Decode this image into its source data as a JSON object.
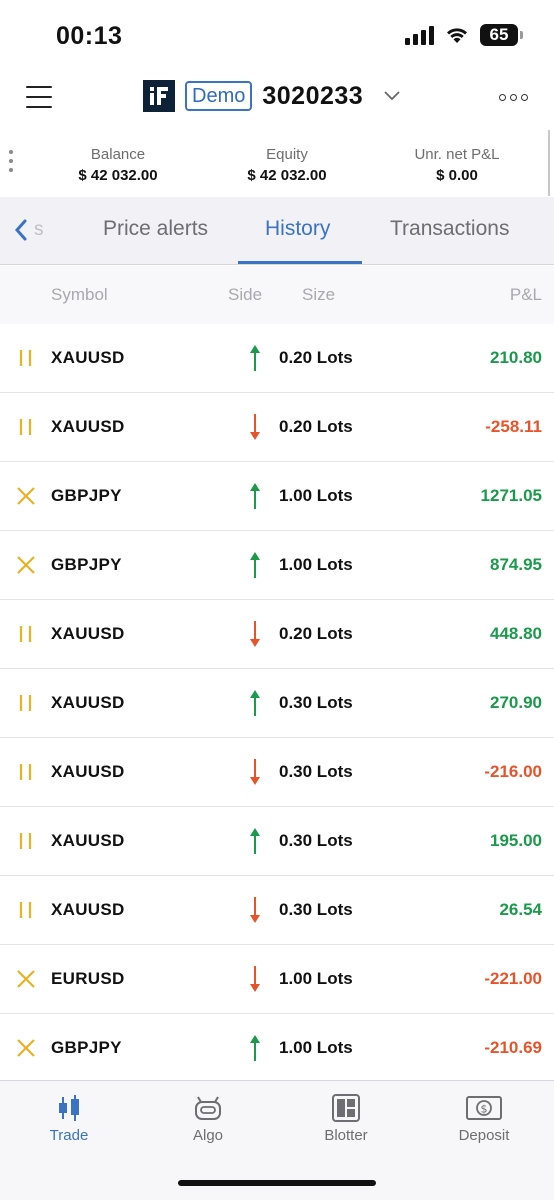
{
  "status_bar": {
    "time": "00:13",
    "battery": "65"
  },
  "header": {
    "badge": "Demo",
    "account_id": "3020233"
  },
  "summary": [
    {
      "label": "Balance",
      "value": "$ 42 032.00"
    },
    {
      "label": "Equity",
      "value": "$ 42 032.00"
    },
    {
      "label": "Unr. net P&L",
      "value": "$ 0.00"
    }
  ],
  "tabs": {
    "back_partial": "s",
    "items": [
      "Price alerts",
      "History",
      "Transactions"
    ],
    "active": "History"
  },
  "columns": {
    "symbol": "Symbol",
    "side": "Side",
    "size": "Size",
    "pnl": "P&L"
  },
  "rows": [
    {
      "status": "pause-icon",
      "symbol": "XAUUSD",
      "side": "buy",
      "size": "0.20 Lots",
      "pnl": "210.80",
      "pnl_sign": "positive"
    },
    {
      "status": "pause-icon",
      "symbol": "XAUUSD",
      "side": "sell",
      "size": "0.20 Lots",
      "pnl": "-258.11",
      "pnl_sign": "negative"
    },
    {
      "status": "close-icon",
      "symbol": "GBPJPY",
      "side": "buy",
      "size": "1.00 Lots",
      "pnl": "1271.05",
      "pnl_sign": "positive"
    },
    {
      "status": "close-icon",
      "symbol": "GBPJPY",
      "side": "buy",
      "size": "1.00 Lots",
      "pnl": "874.95",
      "pnl_sign": "positive"
    },
    {
      "status": "pause-icon",
      "symbol": "XAUUSD",
      "side": "sell",
      "size": "0.20 Lots",
      "pnl": "448.80",
      "pnl_sign": "positive"
    },
    {
      "status": "pause-icon",
      "symbol": "XAUUSD",
      "side": "buy",
      "size": "0.30 Lots",
      "pnl": "270.90",
      "pnl_sign": "positive"
    },
    {
      "status": "pause-icon",
      "symbol": "XAUUSD",
      "side": "sell",
      "size": "0.30 Lots",
      "pnl": "-216.00",
      "pnl_sign": "negative"
    },
    {
      "status": "pause-icon",
      "symbol": "XAUUSD",
      "side": "buy",
      "size": "0.30 Lots",
      "pnl": "195.00",
      "pnl_sign": "positive"
    },
    {
      "status": "pause-icon",
      "symbol": "XAUUSD",
      "side": "sell",
      "size": "0.30 Lots",
      "pnl": "26.54",
      "pnl_sign": "positive"
    },
    {
      "status": "close-icon",
      "symbol": "EURUSD",
      "side": "sell",
      "size": "1.00 Lots",
      "pnl": "-221.00",
      "pnl_sign": "negative"
    },
    {
      "status": "close-icon",
      "symbol": "GBPJPY",
      "side": "buy",
      "size": "1.00 Lots",
      "pnl": "-210.69",
      "pnl_sign": "negative"
    }
  ],
  "bottom_nav": [
    {
      "label": "Trade",
      "icon": "candlestick-icon",
      "active": true
    },
    {
      "label": "Algo",
      "icon": "robot-icon",
      "active": false
    },
    {
      "label": "Blotter",
      "icon": "blotter-icon",
      "active": false
    },
    {
      "label": "Deposit",
      "icon": "deposit-icon",
      "active": false
    }
  ],
  "colors": {
    "accent": "#3a73c4",
    "positive": "#1a9a4a",
    "negative": "#e8542a",
    "status_icon": "#e6b325"
  }
}
